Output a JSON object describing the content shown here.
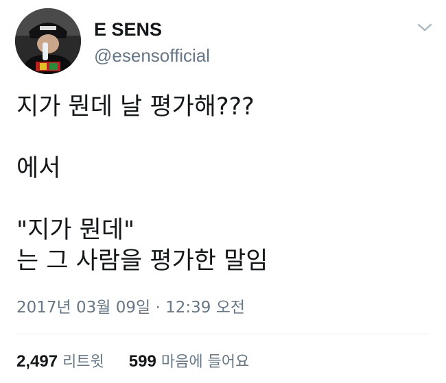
{
  "author": {
    "display_name": "E SENS",
    "handle": "@esensofficial",
    "avatar_icon": "profile-photo"
  },
  "menu": {
    "icon": "chevron-down-icon"
  },
  "tweet": {
    "lines": [
      "지가 뭔데 날 평가해???",
      "",
      "에서",
      "",
      "\"지가 뭔데\"",
      "는 그 사람을 평가한 말임"
    ],
    "timestamp": "2017년 03월 09일 · 12:39 오전"
  },
  "stats": {
    "retweets_count": "2,497",
    "retweets_label": "리트윗",
    "likes_count": "599",
    "likes_label": "마음에 들어요"
  },
  "colors": {
    "text": "#14171a",
    "secondary": "#657786",
    "divider": "#e6ecf0"
  }
}
